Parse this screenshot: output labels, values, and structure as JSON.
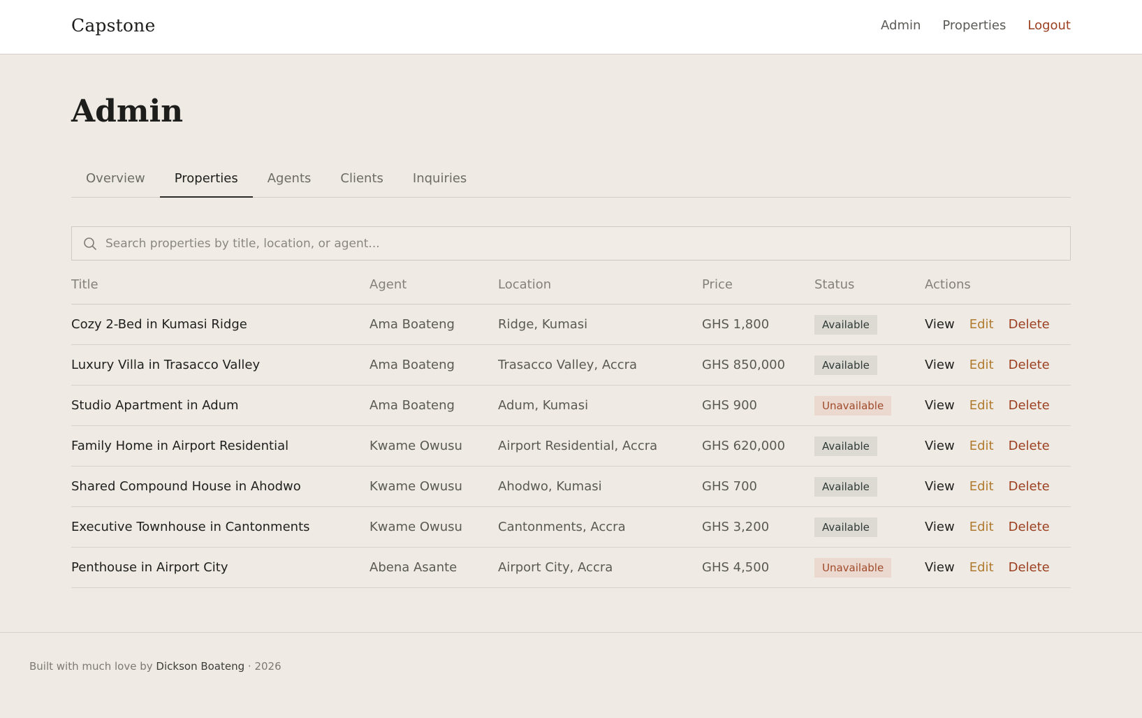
{
  "header": {
    "brand": "Capstone",
    "nav": [
      {
        "label": "Admin"
      },
      {
        "label": "Properties"
      },
      {
        "label": "Logout"
      }
    ]
  },
  "page": {
    "title": "Admin"
  },
  "tabs": [
    {
      "label": "Overview",
      "active": false
    },
    {
      "label": "Properties",
      "active": true
    },
    {
      "label": "Agents",
      "active": false
    },
    {
      "label": "Clients",
      "active": false
    },
    {
      "label": "Inquiries",
      "active": false
    }
  ],
  "search": {
    "placeholder": "Search properties by title, location, or agent...",
    "value": "",
    "icon": "search-icon"
  },
  "table": {
    "headers": [
      "Title",
      "Agent",
      "Location",
      "Price",
      "Status",
      "Actions"
    ],
    "actions": {
      "view": "View",
      "edit": "Edit",
      "delete": "Delete"
    },
    "rows": [
      {
        "title": "Cozy 2-Bed in Kumasi Ridge",
        "agent": "Ama Boateng",
        "location": "Ridge, Kumasi",
        "price": "GHS 1,800",
        "status": "Available"
      },
      {
        "title": "Luxury Villa in Trasacco Valley",
        "agent": "Ama Boateng",
        "location": "Trasacco Valley, Accra",
        "price": "GHS 850,000",
        "status": "Available"
      },
      {
        "title": "Studio Apartment in Adum",
        "agent": "Ama Boateng",
        "location": "Adum, Kumasi",
        "price": "GHS 900",
        "status": "Unavailable"
      },
      {
        "title": "Family Home in Airport Residential",
        "agent": "Kwame Owusu",
        "location": "Airport Residential, Accra",
        "price": "GHS 620,000",
        "status": "Available"
      },
      {
        "title": "Shared Compound House in Ahodwo",
        "agent": "Kwame Owusu",
        "location": "Ahodwo, Kumasi",
        "price": "GHS 700",
        "status": "Available"
      },
      {
        "title": "Executive Townhouse in Cantonments",
        "agent": "Kwame Owusu",
        "location": "Cantonments, Accra",
        "price": "GHS 3,200",
        "status": "Available"
      },
      {
        "title": "Penthouse in Airport City",
        "agent": "Abena Asante",
        "location": "Airport City, Accra",
        "price": "GHS 4,500",
        "status": "Unavailable"
      }
    ]
  },
  "footer": {
    "prefix": "Built with much love by",
    "author": "Dickson Boateng",
    "suffix": "· 2026"
  },
  "colors": {
    "background": "#efebe4",
    "accent_logout": "#9b3f1f",
    "edit": "#b07a2e",
    "delete": "#9b3f1f",
    "badge_available": "#dcdad3",
    "badge_unavailable": "#ebd9d0"
  }
}
